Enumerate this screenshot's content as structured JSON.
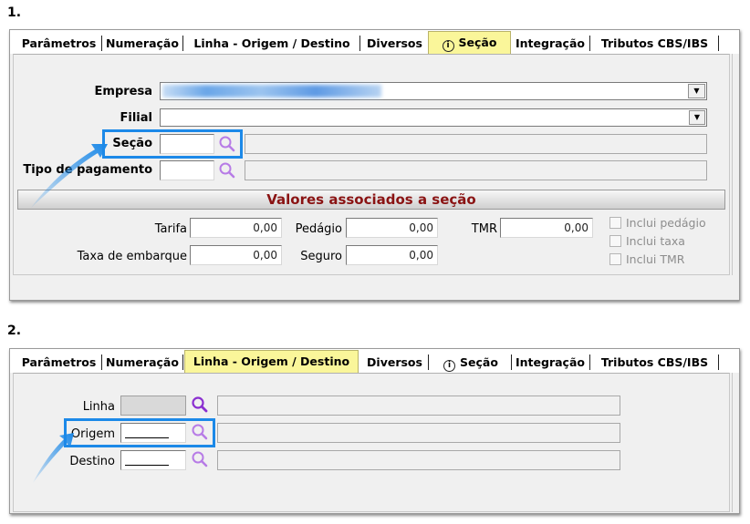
{
  "steps": [
    "1.",
    "2."
  ],
  "tabs": {
    "parametros": "Parâmetros",
    "numeracao": "Numeração",
    "linha": "Linha - Origem / Destino",
    "diversos": "Diversos",
    "secao": "Seção",
    "integracao": "Integração",
    "tributos": "Tributos CBS/IBS"
  },
  "panel1": {
    "labels": {
      "empresa": "Empresa",
      "filial": "Filial",
      "secao": "Seção",
      "tipo_pagamento": "Tipo de pagamento"
    },
    "group_title": "Valores associados a seção",
    "values": {
      "tarifa_label": "Tarifa",
      "tarifa": "0,00",
      "pedagio_label": "Pedágio",
      "pedagio": "0,00",
      "tmr_label": "TMR",
      "tmr": "0,00",
      "taxa_label": "Taxa de embarque",
      "taxa": "0,00",
      "seguro_label": "Seguro",
      "seguro": "0,00"
    },
    "checkboxes": {
      "inclui_pedagio": "Inclui pedágio",
      "inclui_taxa": "Inclui taxa",
      "inclui_tmr": "Inclui TMR"
    }
  },
  "panel2": {
    "labels": {
      "linha": "Linha",
      "origem": "Origem",
      "destino": "Destino"
    }
  },
  "colors": {
    "highlight": "#1c89e8",
    "active_tab": "#faf69a",
    "group_title": "#8a1313",
    "lens": "#9b3fd6"
  },
  "icons": {
    "lookup": "magnifier-icon",
    "info": "info-icon",
    "dropdown": "chevron-down-icon"
  }
}
